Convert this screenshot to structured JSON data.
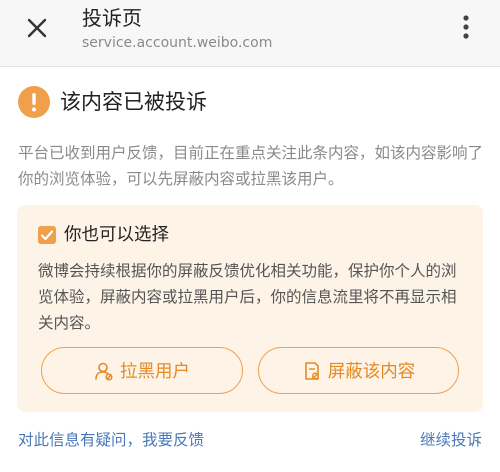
{
  "appbar": {
    "title": "投诉页",
    "url": "service.account.weibo.com",
    "close_icon": "close-icon",
    "more_icon": "more-vertical-icon"
  },
  "notice": {
    "icon": "exclamation-circle-icon",
    "icon_color": "#f0a04b",
    "heading": "该内容已被投诉",
    "description": "平台已收到用户反馈，目前正在重点关注此条内容，如该内容影响了你的浏览体验，可以先屏蔽内容或拉黑该用户。"
  },
  "options_card": {
    "icon": "checkbox-icon",
    "title": "你也可以选择",
    "body": "微博会持续根据你的屏蔽反馈优化相关功能，保护你个人的浏览体验，屏蔽内容或拉黑用户后，你的信息流里将不再显示相关内容。",
    "block_user_button": {
      "icon": "user-icon",
      "label": "拉黑用户"
    },
    "hide_content_button": {
      "icon": "document-icon",
      "label": "屏蔽该内容"
    },
    "accent_color": "#e58a23",
    "background_color": "#fdf3e7"
  },
  "footer": {
    "feedback_link": "对此信息有疑问，我要反馈",
    "continue_link": "继续投诉",
    "link_color": "#4a78b9"
  }
}
